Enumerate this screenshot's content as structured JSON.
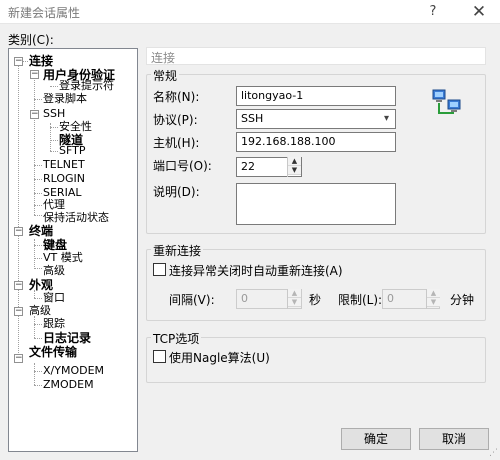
{
  "window": {
    "title": "新建会话属性",
    "help_glyph": "?",
    "close_glyph": "✕"
  },
  "category_label": "类别(C):",
  "tree": {
    "connection": "连接",
    "user_auth": "用户身份验证",
    "login_prompts": "登录提示符",
    "login_script": "登录脚本",
    "ssh": "SSH",
    "security": "安全性",
    "tunnel": "隧道",
    "sftp": "SFTP",
    "telnet": "TELNET",
    "rlogin": "RLOGIN",
    "serial": "SERIAL",
    "proxy": "代理",
    "keepalive": "保持活动状态",
    "terminal": "终端",
    "keyboard": "键盘",
    "vt_mode": "VT 模式",
    "advanced": "高级",
    "appearance": "外观",
    "window": "窗口",
    "advanced2": "高级",
    "trace": "跟踪",
    "log": "日志记录",
    "file_transfer": "文件传输",
    "xymodem": "X/YMODEM",
    "zmodem": "ZMODEM"
  },
  "section_title": "连接",
  "general": {
    "group_title": "常规",
    "name_label": "名称(N):",
    "name_value": "litongyao-1",
    "protocol_label": "协议(P):",
    "protocol_value": "SSH",
    "host_label": "主机(H):",
    "host_value": "192.168.188.100",
    "port_label": "端口号(O):",
    "port_value": "22",
    "desc_label": "说明(D):",
    "desc_value": ""
  },
  "reconnect": {
    "group_title": "重新连接",
    "auto_label": "连接异常关闭时自动重新连接(A)",
    "interval_label": "间隔(V):",
    "interval_value": "0",
    "seconds_unit": "秒",
    "limit_label": "限制(L):",
    "limit_value": "0",
    "minutes_unit": "分钟"
  },
  "tcp": {
    "group_title": "TCP选项",
    "nagle_label": "使用Nagle算法(U)"
  },
  "buttons": {
    "ok": "确定",
    "cancel": "取消"
  },
  "colors": {
    "selected_bg": "#ffffff",
    "accent_blue": "#1e7fd8"
  }
}
